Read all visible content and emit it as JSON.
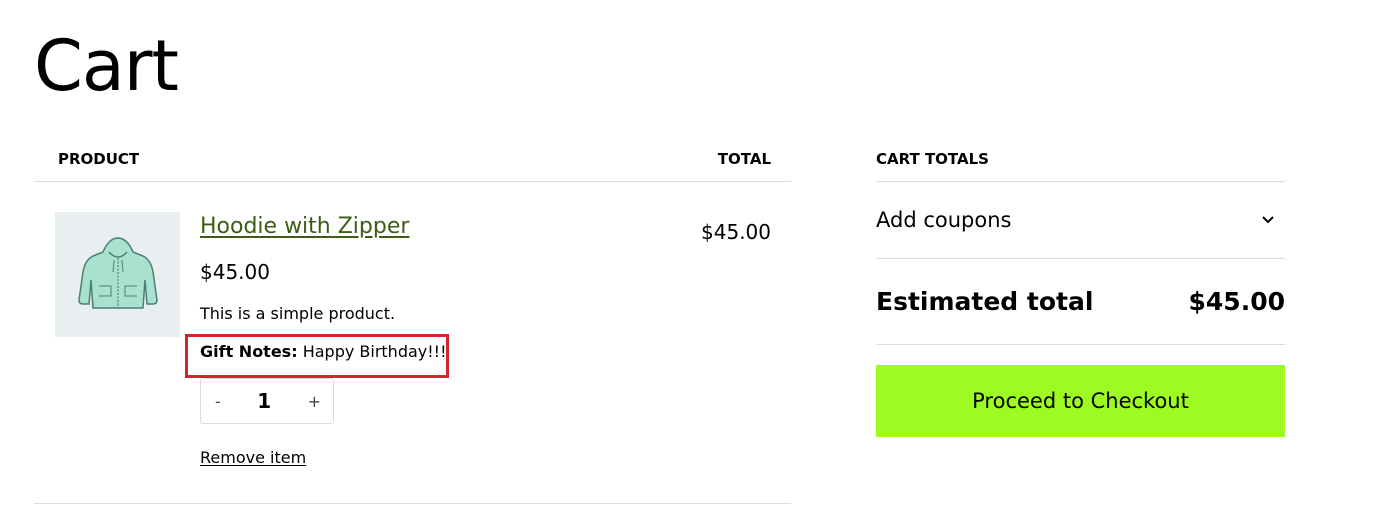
{
  "page": {
    "title": "Cart"
  },
  "cart_table": {
    "headers": {
      "product": "PRODUCT",
      "total": "TOTAL"
    },
    "item": {
      "name": "Hoodie with Zipper",
      "price": "$45.00",
      "description": "This is a simple product.",
      "gift_notes_label": "Gift Notes:",
      "gift_notes_value": "Happy Birthday!!!",
      "quantity": "1",
      "decrease_label": "-",
      "increase_label": "+",
      "remove_label": "Remove item",
      "line_total": "$45.00",
      "image_icon": "hoodie-icon"
    }
  },
  "totals": {
    "heading": "CART TOTALS",
    "coupons_label": "Add coupons",
    "estimated_label": "Estimated total",
    "estimated_value": "$45.00",
    "checkout_label": "Proceed to Checkout"
  },
  "colors": {
    "checkout_button": "#9dfb22",
    "product_link": "#3d5c16",
    "highlight_box": "#d3252b",
    "thumbnail_bg": "#e9eef1"
  }
}
